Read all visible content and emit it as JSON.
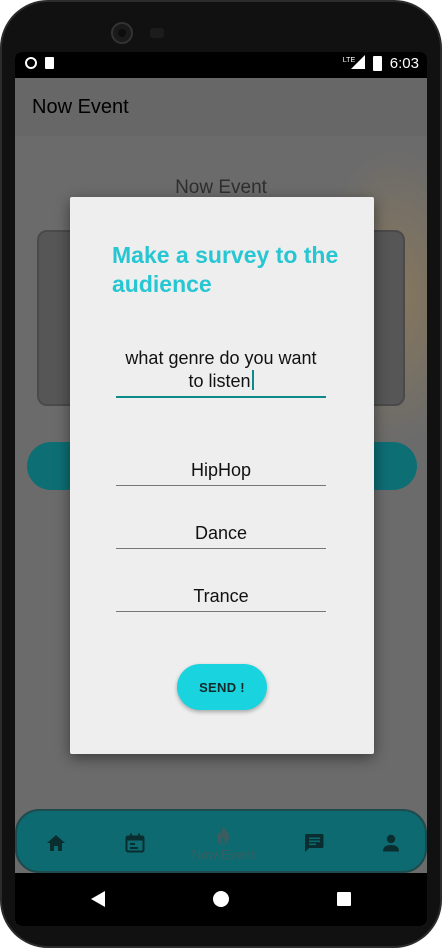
{
  "status_bar": {
    "network": "LTE",
    "time": "6:03"
  },
  "app_bar": {
    "title": "Now Event"
  },
  "background": {
    "section_title": "Now Event"
  },
  "dialog": {
    "title": "Make a survey to the audience",
    "question_value": "what genre do you want to listen",
    "options": [
      "HipHop",
      "Dance",
      "Trance"
    ],
    "send_label": "SEND !"
  },
  "bottom_nav": {
    "items": [
      {
        "icon": "home-icon"
      },
      {
        "icon": "calendar-icon"
      },
      {
        "icon": "flame-icon",
        "label": "Now Event"
      },
      {
        "icon": "chat-icon"
      },
      {
        "icon": "person-icon"
      }
    ]
  },
  "colors": {
    "accent": "#26c6d2",
    "button": "#19d3df",
    "nav_bg": "#0c6a70"
  }
}
